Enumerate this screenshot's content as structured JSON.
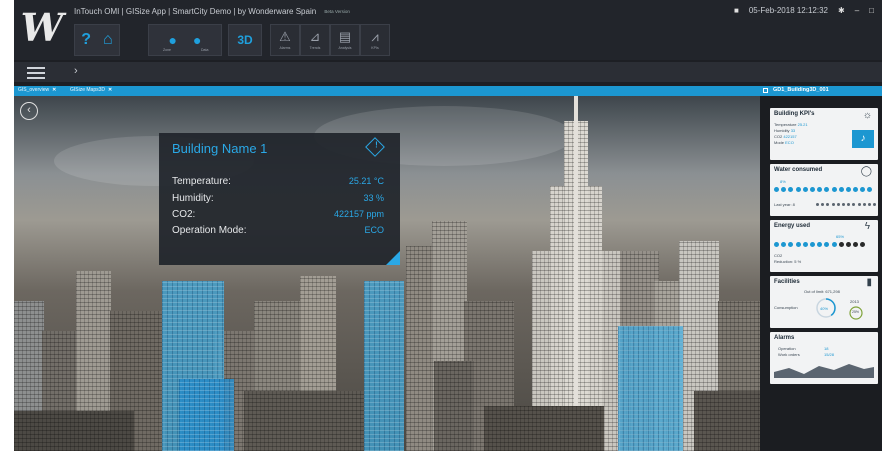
{
  "header": {
    "logo_text": "W",
    "title": "InTouch OMI | GISize App | SmartCity Demo | by Wonderware Spain",
    "beta": "Beta Version",
    "datetime": "05-Feb-2018 12:12:32"
  },
  "toolbar": {
    "help": "?",
    "pin_sub": "Zone",
    "pin2_sub": "Data",
    "three_d": "3D",
    "buttons": [
      {
        "icon": "⚠",
        "label": "Alarms"
      },
      {
        "icon": "⊿",
        "label": "Trends"
      },
      {
        "icon": "▤",
        "label": "Analysis"
      },
      {
        "icon": "⩘",
        "label": "KPIs"
      }
    ]
  },
  "tabs": [
    {
      "label": "GIS_overview",
      "close": "✕"
    },
    {
      "label": "GISize Maps3D",
      "close": "✕"
    }
  ],
  "info_card": {
    "title": "Building Name 1",
    "rows": [
      {
        "key": "Temperature:",
        "value": "25.21 °C"
      },
      {
        "key": "Humidity:",
        "value": "33 %"
      },
      {
        "key": "CO2:",
        "value": "422157 ppm"
      },
      {
        "key": "Operation Mode:",
        "value": "ECO"
      }
    ]
  },
  "right_panel": {
    "title": "GD1_Building3D_001",
    "kpi": {
      "title": "Building KPI's",
      "rows": [
        {
          "k": "Temperature",
          "v": "25.21"
        },
        {
          "k": "Humidity",
          "v": "33"
        },
        {
          "k": "CO2",
          "v": "422157"
        },
        {
          "k": "Mode",
          "v": "ECO"
        }
      ]
    },
    "water": {
      "title": "Water consumed",
      "pct": "8%",
      "last_year": "Last year: 8"
    },
    "energy": {
      "title": "Energy used",
      "pct": "65%",
      "co2_label": "CO2",
      "reduction": "Reduction: 5 %"
    },
    "facilities": {
      "title": "Facilities",
      "out_of_limit": "Out of limit: 671,298",
      "consumption_label": "Consumption",
      "consumption_pct": "40%",
      "year": "2013",
      "year_pct": "25%"
    },
    "alarms": {
      "title": "Alarms",
      "rows": [
        {
          "k": "Operation",
          "v": "18"
        },
        {
          "k": "Work orders",
          "v": "15/28"
        }
      ]
    }
  }
}
